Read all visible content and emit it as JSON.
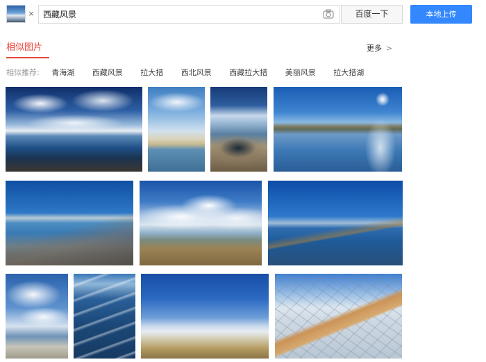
{
  "search": {
    "query": "西藏风景",
    "submit_label": "百度一下",
    "upload_label": "本地上传",
    "close_glyph": "×"
  },
  "section": {
    "title": "相似图片",
    "more_label": "更多",
    "more_chevron": ">"
  },
  "tags": {
    "label": "相似推荐:",
    "items": [
      "青海湖",
      "西藏风景",
      "拉大措",
      "西北风景",
      "西藏拉大措",
      "美丽风景",
      "拉大措湖"
    ]
  },
  "images": [
    {
      "name": "image-lake-clouds-wide"
    },
    {
      "name": "image-lake-shore-tall"
    },
    {
      "name": "image-mud-rock-tall"
    },
    {
      "name": "image-sun-lake"
    },
    {
      "name": "image-blue-shore"
    },
    {
      "name": "image-cloudy-plain"
    },
    {
      "name": "image-blue-lake-field"
    },
    {
      "name": "image-sky-clouds-portrait"
    },
    {
      "name": "image-wave-water-portrait"
    },
    {
      "name": "image-horizon-beach"
    },
    {
      "name": "image-cracked-salt-flat"
    }
  ],
  "colors": {
    "accent_red": "#e8453c",
    "upload_blue": "#3388ff"
  }
}
